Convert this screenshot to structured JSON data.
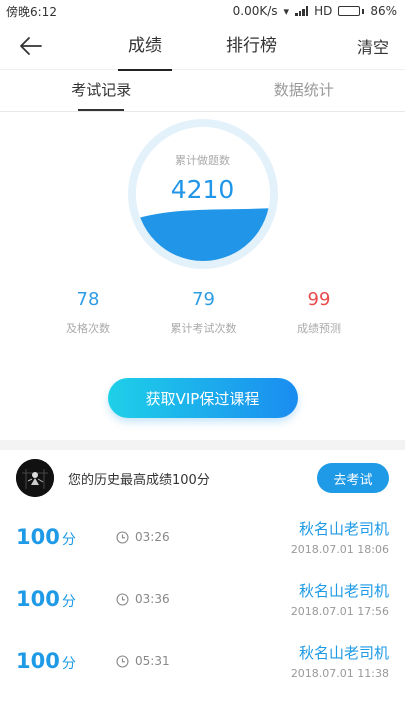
{
  "status_bar": {
    "time": "傍晚6:12",
    "network_speed": "0.00K/s",
    "network_type": "HD",
    "battery": "86%",
    "battery_level": 0.86
  },
  "nav": {
    "tabs": [
      "成绩",
      "排行榜"
    ],
    "active_tab": 0,
    "clear_label": "清空"
  },
  "subtabs": {
    "items": [
      "考试记录",
      "数据统计"
    ],
    "active": 0
  },
  "summary": {
    "label": "累计做题数",
    "value": "4210",
    "fill_level": 0.35
  },
  "stats": [
    {
      "value": "78",
      "label": "及格次数",
      "color": "#2e9de6"
    },
    {
      "value": "79",
      "label": "累计考试次数",
      "color": "#2e9de6"
    },
    {
      "value": "99",
      "label": "成绩预测",
      "color": "#e94b4b"
    }
  ],
  "vip_button": "获取VIP保过课程",
  "best": {
    "text": "您的历史最高成绩100分",
    "button": "去考试"
  },
  "records": [
    {
      "score": "100",
      "unit": "分",
      "duration": "03:26",
      "name": "秋名山老司机",
      "date": "2018.07.01  18:06"
    },
    {
      "score": "100",
      "unit": "分",
      "duration": "03:36",
      "name": "秋名山老司机",
      "date": "2018.07.01  17:56"
    },
    {
      "score": "100",
      "unit": "分",
      "duration": "05:31",
      "name": "秋名山老司机",
      "date": "2018.07.01  11:38"
    }
  ],
  "colors": {
    "accent": "#1e9ae6",
    "wave": "#2196e8",
    "ring": "#e3f1fb",
    "danger": "#e94b4b"
  }
}
